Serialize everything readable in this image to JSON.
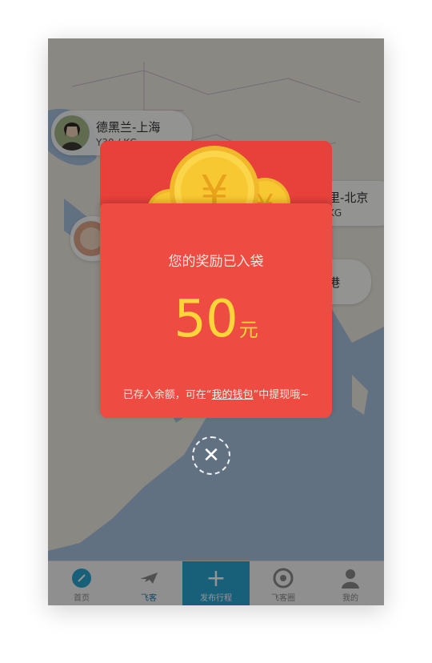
{
  "map_pins": [
    {
      "route": "德黑兰-上海",
      "weight": "Y30 / KG"
    },
    {
      "route": "里-北京",
      "weight": "KG"
    },
    {
      "route": "港",
      "weight": ""
    }
  ],
  "tabs": [
    {
      "label": "首页",
      "icon": "compass-icon"
    },
    {
      "label": "飞客",
      "icon": "plane-icon"
    },
    {
      "label": "发布行程",
      "icon": "plus-icon"
    },
    {
      "label": "飞客圈",
      "icon": "aperture-icon"
    },
    {
      "label": "我的",
      "icon": "person-icon"
    }
  ],
  "reward": {
    "coin_symbol": "¥",
    "title": "您的奖励已入袋",
    "amount": "50",
    "unit": "元",
    "note_prefix": "已存入余额，可在“",
    "note_link": "我的钱包",
    "note_suffix": "”中提现哦~"
  },
  "close_symbol": "✕",
  "colors": {
    "envelope_red": "#ee4b43",
    "coin_gold": "#f8c832",
    "amount_yellow": "#ffd53a",
    "tab_accent": "#2aa6d2"
  }
}
